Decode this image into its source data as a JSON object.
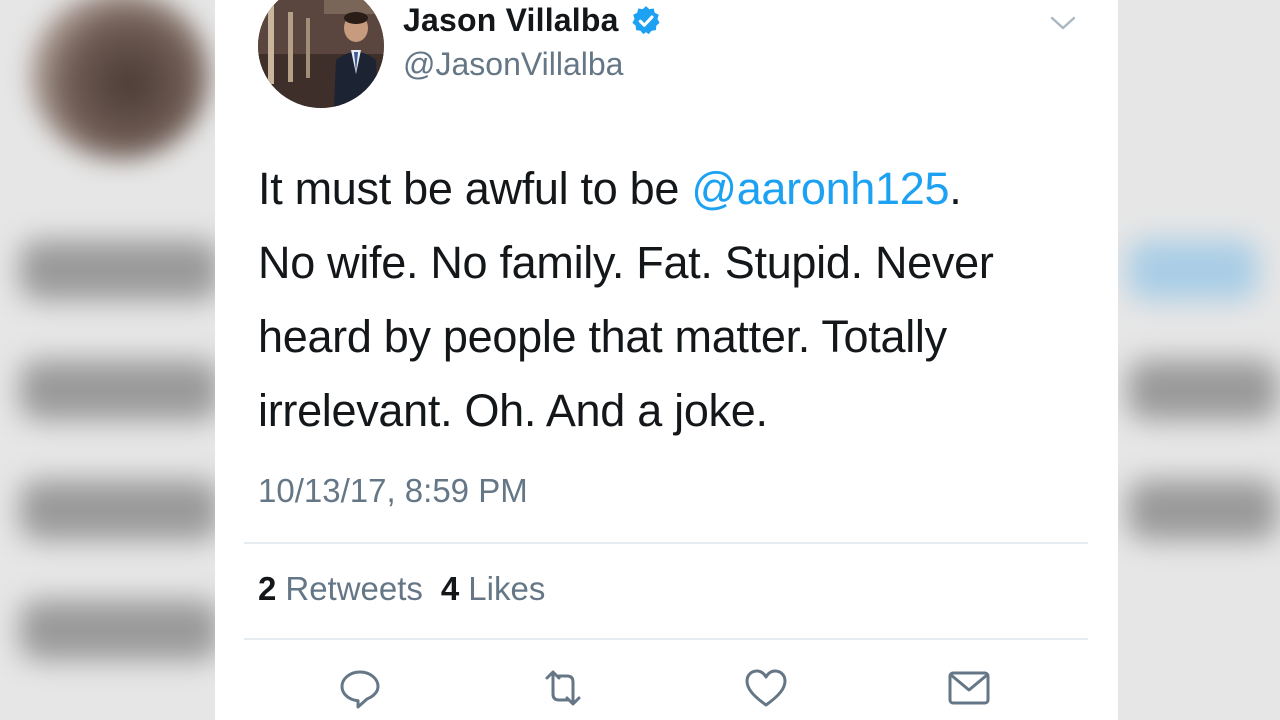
{
  "tweet": {
    "author": {
      "display_name": "Jason Villalba",
      "handle": "@JasonVillalba",
      "verified": true
    },
    "text": {
      "line1_before": "It must be awful to be ",
      "mention": "@aaronh125",
      "line1_after": ".",
      "line2": "No wife. No family. Fat. Stupid. Never",
      "line3": "heard by people that matter. Totally",
      "line4": "irrelevant. Oh. And a joke."
    },
    "timestamp": "10/13/17, 8:59 PM",
    "stats": {
      "retweets_count": "2",
      "retweets_label": "Retweets",
      "likes_count": "4",
      "likes_label": "Likes"
    },
    "actions": [
      {
        "name": "reply-icon"
      },
      {
        "name": "retweet-icon"
      },
      {
        "name": "like-icon"
      },
      {
        "name": "direct-message-icon"
      }
    ],
    "colors": {
      "accent": "#1da1f2",
      "text": "#14171a",
      "secondary": "#657786"
    }
  }
}
